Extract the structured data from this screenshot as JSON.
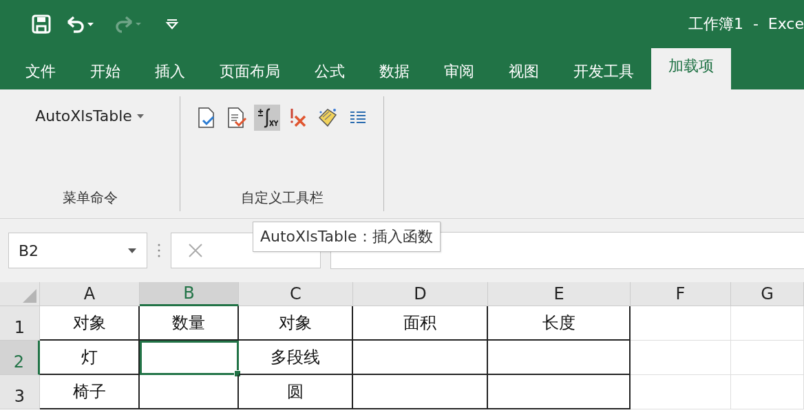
{
  "window": {
    "title": "工作簿1  -  Exce"
  },
  "quick_access": [
    {
      "kind": "save",
      "disabled": false
    },
    {
      "kind": "undo",
      "disabled": false
    },
    {
      "kind": "redo",
      "disabled": true
    },
    {
      "kind": "customize",
      "disabled": false
    }
  ],
  "tabs": [
    {
      "label": "文件",
      "selected": false
    },
    {
      "label": "开始",
      "selected": false
    },
    {
      "label": "插入",
      "selected": false
    },
    {
      "label": "页面布局",
      "selected": false
    },
    {
      "label": "公式",
      "selected": false
    },
    {
      "label": "数据",
      "selected": false
    },
    {
      "label": "审阅",
      "selected": false
    },
    {
      "label": "视图",
      "selected": false
    },
    {
      "label": "开发工具",
      "selected": false
    },
    {
      "label": "加载项",
      "selected": true
    }
  ],
  "ribbon": {
    "groups": [
      {
        "label": "菜单命令",
        "menu": "AutoXlsTable"
      },
      {
        "label": "自定义工具栏",
        "tools": [
          {
            "kind": "doc-check",
            "selected": false
          },
          {
            "kind": "doc-edit",
            "selected": false
          },
          {
            "kind": "function",
            "selected": true
          },
          {
            "kind": "clear",
            "selected": false
          },
          {
            "kind": "highlighter",
            "selected": false
          },
          {
            "kind": "list",
            "selected": false
          }
        ]
      }
    ]
  },
  "tooltip": "AutoXlsTable：插入函数",
  "name_box": "B2",
  "columns": [
    {
      "label": "A",
      "selected": false,
      "bordered": true
    },
    {
      "label": "B",
      "selected": true,
      "bordered": true
    },
    {
      "label": "C",
      "selected": false,
      "bordered": true
    },
    {
      "label": "D",
      "selected": false,
      "bordered": true
    },
    {
      "label": "E",
      "selected": false,
      "bordered": true
    },
    {
      "label": "F",
      "selected": false,
      "bordered": false
    },
    {
      "label": "G",
      "selected": false,
      "bordered": false
    }
  ],
  "rows": [
    {
      "number": "1",
      "selected": false,
      "cells": [
        {
          "value": "对象",
          "selected": false
        },
        {
          "value": "数量",
          "selected": false
        },
        {
          "value": "对象",
          "selected": false
        },
        {
          "value": "面积",
          "selected": false
        },
        {
          "value": "长度",
          "selected": false
        }
      ]
    },
    {
      "number": "2",
      "selected": true,
      "cells": [
        {
          "value": "灯",
          "selected": false
        },
        {
          "selected": true
        },
        {
          "value": "多段线",
          "selected": false
        },
        {
          "selected": false
        },
        {
          "selected": false
        }
      ]
    },
    {
      "number": "3",
      "selected": false,
      "cells": [
        {
          "value": "椅子",
          "selected": false
        },
        {
          "selected": false
        },
        {
          "value": "圆",
          "selected": false
        },
        {
          "selected": false
        },
        {
          "selected": false
        }
      ]
    }
  ]
}
